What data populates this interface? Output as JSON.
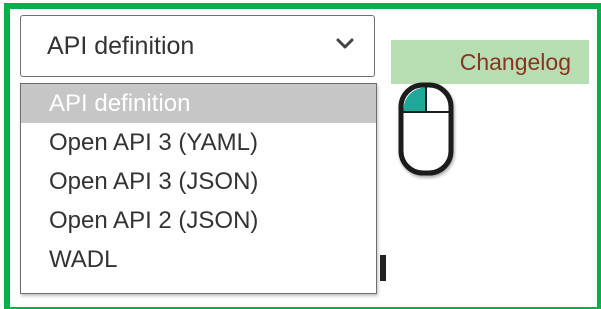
{
  "select": {
    "value": "API definition",
    "chevron_icon": "chevron-down-icon"
  },
  "dropdown": {
    "options": [
      "API definition",
      "Open API 3 (YAML)",
      "Open API 3 (JSON)",
      "Open API 2 (JSON)",
      "WADL"
    ],
    "selected_index": 0
  },
  "changelog": {
    "label": "Changelog"
  },
  "cursor": {
    "icon": "mouse-cursor-icon"
  },
  "colors": {
    "frame_border": "#00b248",
    "selected_option_bg": "#c6c6c6",
    "changelog_bg": "#b7ddb2",
    "changelog_text": "#8a3321",
    "mouse_accent": "#1fa89a"
  }
}
